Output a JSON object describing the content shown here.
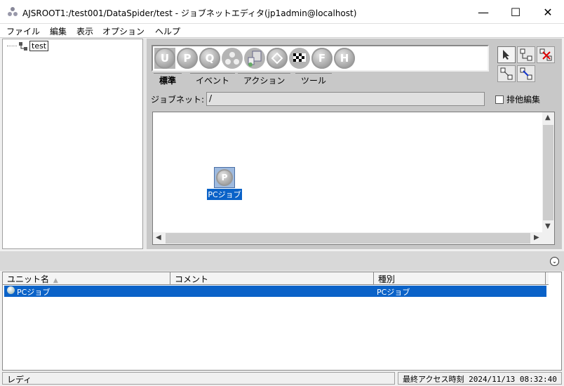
{
  "window": {
    "title": "AJSROOT1:/test001/DataSpider/test - ジョブネットエディタ(jp1admin@localhost)"
  },
  "window_controls": {
    "minimize": "—",
    "maximize": "☐",
    "close": "✕"
  },
  "menu": [
    "ファイル",
    "編集",
    "表示",
    "オプション",
    "ヘルプ"
  ],
  "tree": {
    "root_label": "test"
  },
  "palette": {
    "icons": [
      "U",
      "P",
      "Q",
      "",
      "",
      "",
      "",
      "F",
      "H"
    ]
  },
  "tabs": [
    "標準",
    "イベント",
    "アクション",
    "ツール"
  ],
  "jobnet": {
    "label": "ジョブネット:",
    "value": "/"
  },
  "exclusive_edit": {
    "label": "排他編集",
    "checked": false
  },
  "canvas": {
    "job_label": "PCジョブ",
    "job_glyph": "P"
  },
  "list": {
    "columns": [
      "ユニット名",
      "コメント",
      "種別"
    ],
    "sort_indicator": "▲",
    "rows": [
      {
        "unit_name": "PCジョブ",
        "comment": "",
        "type": "PCジョブ"
      }
    ]
  },
  "status": {
    "left": "レディ",
    "right": "最終アクセス時刻 2024/11/13 08:32:40"
  }
}
